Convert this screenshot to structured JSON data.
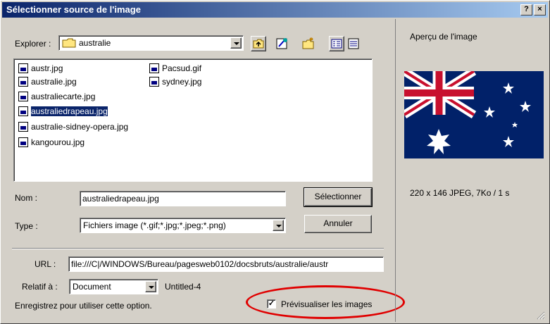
{
  "window": {
    "title": "Sélectionner source de l'image",
    "help_button": "?",
    "close_button": "×"
  },
  "explorer": {
    "label": "Explorer :",
    "folder": "australie"
  },
  "files": {
    "col1": [
      "austr.jpg",
      "australie.jpg",
      "australiecarte.jpg",
      "australiedrapeau.jpg",
      "australie-sidney-opera.jpg",
      "kangourou.jpg"
    ],
    "col2": [
      "Pacsud.gif",
      "sydney.jpg"
    ],
    "selected": "australiedrapeau.jpg"
  },
  "nom": {
    "label": "Nom :",
    "value": "australiedrapeau.jpg"
  },
  "type": {
    "label": "Type :",
    "value": "Fichiers image (*.gif;*.jpg;*.jpeg;*.png)"
  },
  "buttons": {
    "select": "Sélectionner",
    "cancel": "Annuler"
  },
  "url": {
    "label": "URL :",
    "value": "file:///C|/WINDOWS/Bureau/pagesweb0102/docsbruts/australie/austr"
  },
  "relatif": {
    "label": "Relatif à :",
    "value": "Document",
    "doc_name": "Untitled-4"
  },
  "save_hint": "Enregistrez pour utiliser cette option.",
  "preview_checkbox": {
    "label": "Prévisualiser les images",
    "checked": true
  },
  "preview": {
    "title": "Aperçu de l'image",
    "info": "220 x 146 JPEG,  7Ko / 1 s"
  },
  "colors": {
    "titlebar": "#0a246a",
    "selection": "#0a246a",
    "highlight_ellipse": "#e00000",
    "flag_blue": "#012169",
    "flag_red": "#c8102e"
  }
}
